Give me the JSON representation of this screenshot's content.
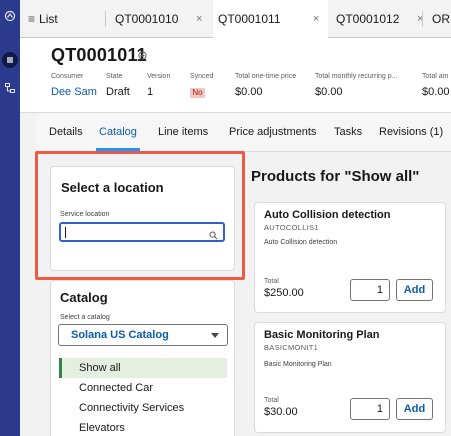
{
  "tabs": {
    "list_label": "List",
    "items": [
      {
        "label": "QT0001010",
        "close": "×"
      },
      {
        "label": "QT0001011",
        "close": "×"
      },
      {
        "label": "QT0001012",
        "close": "×"
      },
      {
        "label": "OR"
      }
    ]
  },
  "record": {
    "title": "QT0001011",
    "fields": [
      {
        "label": "Consumer",
        "value": "Dee Sam"
      },
      {
        "label": "State",
        "value": "Draft"
      },
      {
        "label": "Version",
        "value": "1"
      },
      {
        "label": "Synced",
        "value": "No"
      },
      {
        "label": "Total one-time price",
        "value": "$0.00"
      },
      {
        "label": "Total monthly recurring p...",
        "value": "$0.00"
      },
      {
        "label": "Total am",
        "value": "$0.00"
      }
    ]
  },
  "subtabs": [
    "Details",
    "Catalog",
    "Line items",
    "Price adjustments",
    "Tasks",
    "Revisions (1)"
  ],
  "location": {
    "title": "Select a location",
    "field_label": "Service location",
    "field_value": ""
  },
  "catalog": {
    "title": "Catalog",
    "select_label": "Select a catalog",
    "select_value": "Solana US Catalog",
    "items": [
      "Show all",
      "Connected Car",
      "Connectivity Services",
      "Elevators"
    ]
  },
  "products": {
    "title": "Products for \"Show all\"",
    "items": [
      {
        "name": "Auto Collision detection",
        "code": "AUTOCOLLIS1",
        "description": "Auto Collision detection",
        "total_label": "Total",
        "total": "$250.00",
        "qty": "1",
        "add_label": "Add"
      },
      {
        "name": "Basic Monitoring Plan",
        "code": "BASICMONIT1",
        "description": "Basic Monitoring Plan",
        "total_label": "Total",
        "total": "$30.00",
        "qty": "1",
        "add_label": "Add"
      }
    ]
  },
  "colors": {
    "rail": "#2b3a8c",
    "link": "#0b5cab",
    "focus": "#2f5fd1",
    "highlight": "#ef5a46",
    "selected_bar": "#2e844a"
  }
}
